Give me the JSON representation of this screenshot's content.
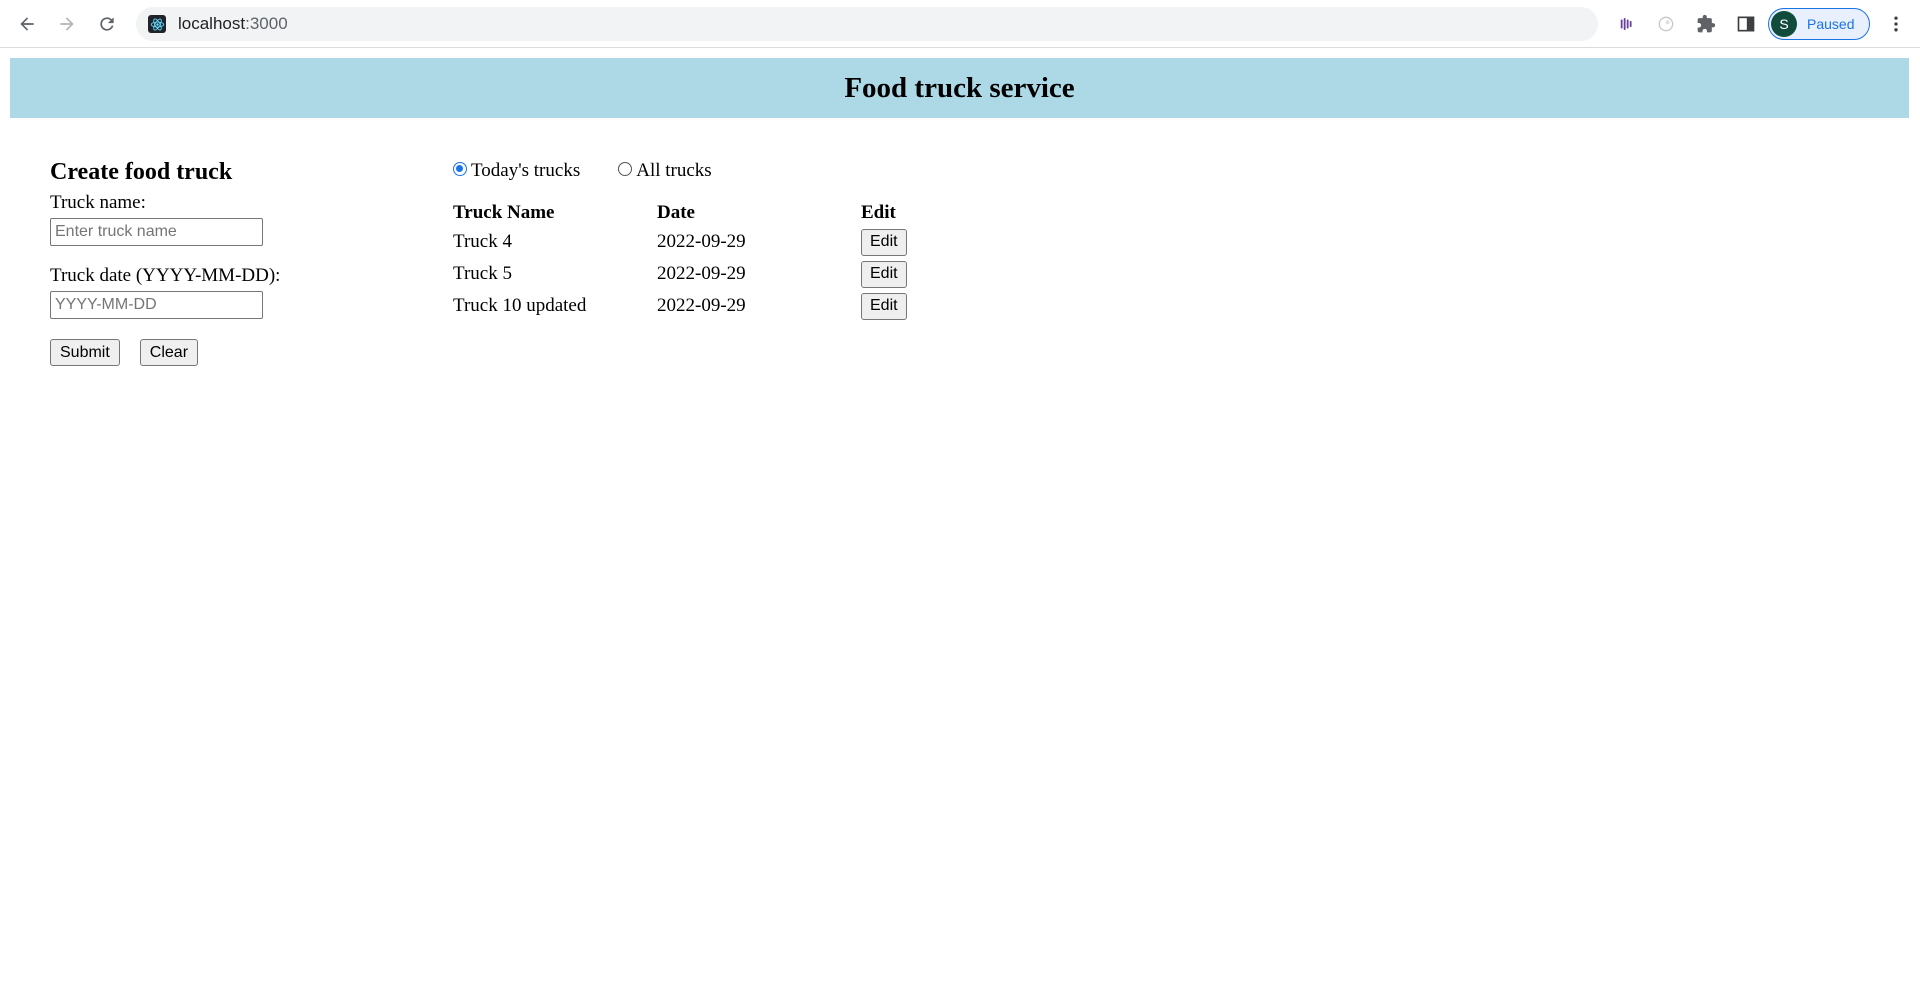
{
  "browser": {
    "url_host": "localhost",
    "url_port": ":3000",
    "profile_initial": "S",
    "profile_status": "Paused"
  },
  "page": {
    "banner_title": "Food truck service",
    "create": {
      "heading": "Create food truck",
      "name_label": "Truck name:",
      "name_placeholder": "Enter truck name",
      "name_value": "",
      "date_label": "Truck date (YYYY-MM-DD):",
      "date_placeholder": "YYYY-MM-DD",
      "date_value": "",
      "submit_label": "Submit",
      "clear_label": "Clear"
    },
    "filter": {
      "options": [
        {
          "label": "Today's trucks",
          "checked": true
        },
        {
          "label": "All trucks",
          "checked": false
        }
      ]
    },
    "table": {
      "headers": [
        "Truck Name",
        "Date",
        "Edit"
      ],
      "rows": [
        {
          "name": "Truck 4",
          "date": "2022-09-29",
          "edit_label": "Edit"
        },
        {
          "name": "Truck 5",
          "date": "2022-09-29",
          "edit_label": "Edit"
        },
        {
          "name": "Truck 10 updated",
          "date": "2022-09-29",
          "edit_label": "Edit"
        }
      ]
    }
  },
  "colors": {
    "banner_bg": "#add8e6",
    "accent": "#1a73e8",
    "avatar_bg": "#114b3c"
  }
}
